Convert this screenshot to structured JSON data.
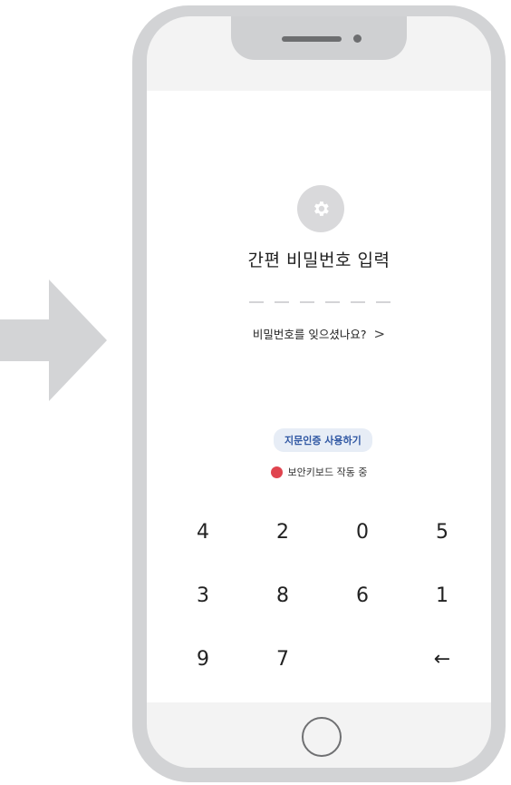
{
  "colors": {
    "phone_frame": "#d2d3d5",
    "bezel": "#f3f3f3",
    "screen": "#ffffff",
    "arrow": "#d3d4d6",
    "accent_blue": "#2f57a3",
    "security_red": "#e0444f"
  },
  "icons": {
    "arrow": "arrow-right-icon",
    "settings": "gear-icon",
    "security": "shield-dot-icon",
    "home": "home-button-icon"
  },
  "login": {
    "title": "간편 비밀번호 입력",
    "pin_length": 6,
    "forgot_password": "비밀번호를 잊으셨나요?",
    "forgot_chevron": ">",
    "fingerprint_button": "지문인증 사용하기",
    "secure_keyboard": "보안키보드 작동 중"
  },
  "keypad": {
    "k1": "4",
    "k2": "2",
    "k3": "0",
    "k4": "5",
    "k5": "3",
    "k6": "8",
    "k7": "6",
    "k8": "1",
    "k9": "9",
    "k10": "7",
    "k11": "",
    "k12": "←"
  }
}
